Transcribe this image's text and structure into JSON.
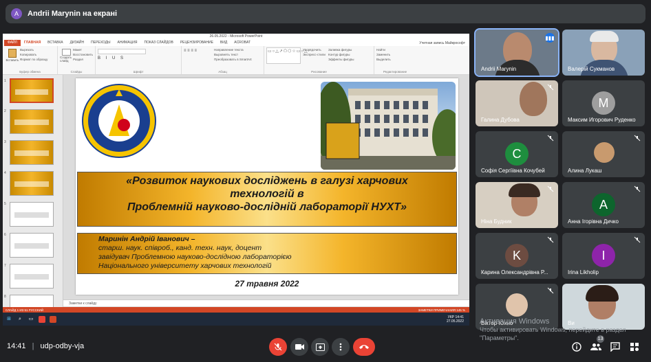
{
  "presenter_bar": {
    "avatar": "A",
    "text": "Andrii Marynin на екрані"
  },
  "powerpoint": {
    "window_title": "26.05.2022 - Microsoft PowerPoint",
    "tabs": [
      "ФАЙЛ",
      "ГЛАВНАЯ",
      "ВСТАВКА",
      "ДИЗАЙН",
      "ПЕРЕХОДЫ",
      "АНИМАЦИЯ",
      "ПОКАЗ СЛАЙДОВ",
      "РЕЦЕНЗИРОВАНИЕ",
      "ВИД",
      "ACROBAT"
    ],
    "account": "Учетная запись Майкрософт",
    "ribbon": {
      "clipboard": {
        "paste": "Вставить",
        "cut": "Вырезать",
        "copy": "Копировать",
        "format": "Формат по образцу",
        "label": "Буфер обмена"
      },
      "slides": {
        "new": "Создать слайд",
        "layout": "Макет",
        "reset": "Восстановить",
        "section": "Раздел",
        "label": "Слайды"
      },
      "font": {
        "label": "Шрифт"
      },
      "paragraph": {
        "direction": "Направление текста",
        "align": "Выровнять текст",
        "smartart": "Преобразовать в SmartArt",
        "label": "Абзац"
      },
      "drawing": {
        "arrange": "Упорядочить",
        "styles": "Экспресс-стили",
        "fill": "Заливка фигуры",
        "outline": "Контур фигуры",
        "effects": "Эффекты фигуры",
        "label": "Рисование"
      },
      "editing": {
        "find": "Найти",
        "replace": "Заменить",
        "select": "Выделить",
        "label": "Редактирование"
      }
    },
    "thumbnail_numbers": [
      "1",
      "2",
      "3",
      "4",
      "5",
      "6",
      "7",
      "8"
    ],
    "slide": {
      "logo_text": "НАЦІОНАЛЬНИЙ УНІВЕРСИТЕТ ХАРЧОВИХ ТЕХНОЛОГІЙ",
      "photo_sign": "НАЦІОНАЛЬНИЙ УНІВЕРСИТЕТ ХАРЧОВИХ ТЕХНОЛОГІЙ",
      "title_l1": "«Розвиток наукових досліджень в галузі харчових",
      "title_l2": "технологій в",
      "title_l3": "Проблемній науково-дослідній лабораторії НУХТ»",
      "author_name": "Маринін Андрій Іванович –",
      "author_l2": "старш. наук. співроб., канд. техн. наук, доцент",
      "author_l3": "завідувач Проблемною науково-дослідною лабораторією",
      "author_l4": "Національного університету харчових технологій",
      "date": "27 травня 2022"
    },
    "notes_placeholder": "Заметки к слайду",
    "status_left": "СЛАЙД 1 ИЗ 51   РУССКИЙ",
    "status_right": "ЗАМЕТКИ   ПРИМЕЧАНИЯ   145 %",
    "taskbar": {
      "lang": "УКР",
      "time": "14:41",
      "date": "27.05.2022"
    }
  },
  "participants": [
    {
      "name": "Andrii Marynin",
      "speaking": true
    },
    {
      "name": "Валерій Сукманов"
    },
    {
      "name": "Галина Дубова"
    },
    {
      "name": "Максим Игорович Руденко",
      "initial": "M",
      "color": "#9e9e9e"
    },
    {
      "name": "Софія Сергіївна Кочубей",
      "initial": "C",
      "color": "#1e8e3e"
    },
    {
      "name": "Алина Лукаш"
    },
    {
      "name": "Ніна Будник"
    },
    {
      "name": "Анна Ігорівна Дичко",
      "initial": "A",
      "color": "#0d652d"
    },
    {
      "name": "Карина Олександрівна Р...",
      "initial": "K",
      "color": "#6d4c41"
    },
    {
      "name": "Irina Likholip",
      "initial": "I",
      "color": "#8e24aa"
    },
    {
      "name": "Віктор Юхно"
    },
    {
      "name": "Ви"
    }
  ],
  "bottom": {
    "time": "14:41",
    "separator": "|",
    "meeting_code": "udp-odby-vja",
    "people_count": "13"
  },
  "watermark": {
    "line1": "Активация Windows",
    "line2": "Чтобы активировать Windows, перейдите в раздел",
    "line3": "\"Параметры\"."
  }
}
